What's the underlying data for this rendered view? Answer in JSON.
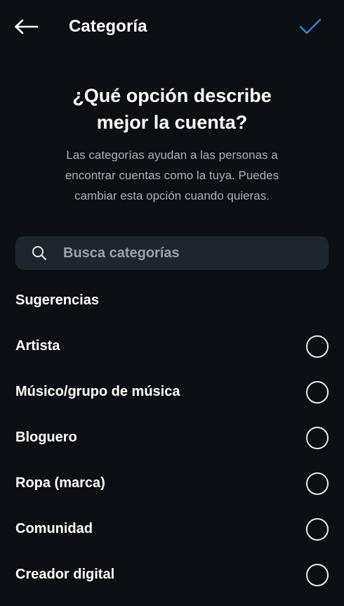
{
  "header": {
    "title": "Categoría",
    "back_icon": "arrow-left-icon",
    "confirm_icon": "checkmark-icon",
    "confirm_color": "#2f7fd0"
  },
  "heading": {
    "line1": "¿Qué opción describe",
    "line2": "mejor la cuenta?"
  },
  "subtitle": {
    "line1": "Las categorías ayudan a las personas a",
    "line2": "encontrar cuentas como la tuya. Puedes",
    "line3": "cambiar esta opción cuando quieras."
  },
  "search": {
    "icon": "search-icon",
    "placeholder": "Busca categorías",
    "value": ""
  },
  "suggestions": {
    "label": "Sugerencias",
    "items": [
      {
        "label": "Artista",
        "selected": false
      },
      {
        "label": "Músico/grupo de música",
        "selected": false
      },
      {
        "label": "Bloguero",
        "selected": false
      },
      {
        "label": "Ropa (marca)",
        "selected": false
      },
      {
        "label": "Comunidad",
        "selected": false
      },
      {
        "label": "Creador digital",
        "selected": false
      }
    ]
  }
}
